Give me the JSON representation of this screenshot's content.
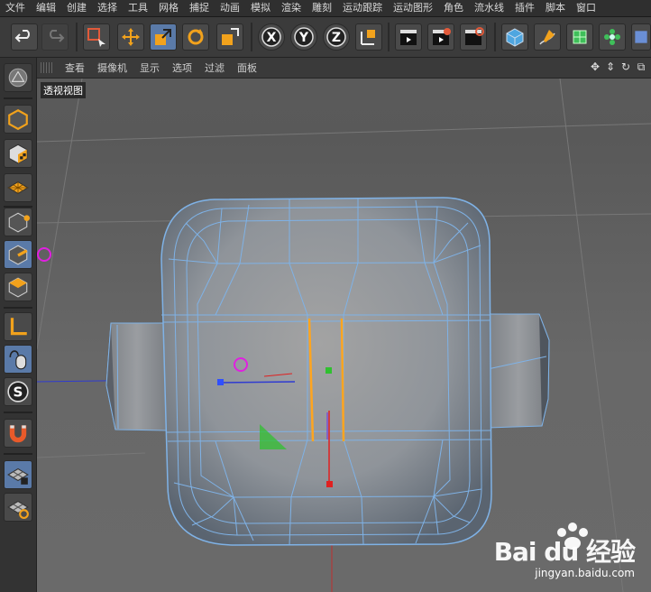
{
  "menu": [
    "文件",
    "编辑",
    "创建",
    "选择",
    "工具",
    "网格",
    "捕捉",
    "动画",
    "模拟",
    "渲染",
    "雕刻",
    "运动跟踪",
    "运动图形",
    "角色",
    "流水线",
    "插件",
    "脚本",
    "窗口"
  ],
  "toolbar": {
    "undo": "undo-icon",
    "redo": "redo-icon",
    "axis_x": "X",
    "axis_y": "Y",
    "axis_z": "Z"
  },
  "viewport_menu": [
    "查看",
    "摄像机",
    "显示",
    "选项",
    "过滤",
    "面板"
  ],
  "viewport_label": "透视视图",
  "watermark": {
    "main": "Bai du 经验",
    "sub": "jingyan.baidu.com"
  },
  "colors": {
    "selection": "#5a7aa8",
    "mesh_wire": "#7fb2e6",
    "edge_highlight": "#ffa51f",
    "axis_x": "#e02020",
    "axis_y": "#30c030",
    "axis_z": "#3050ff"
  }
}
